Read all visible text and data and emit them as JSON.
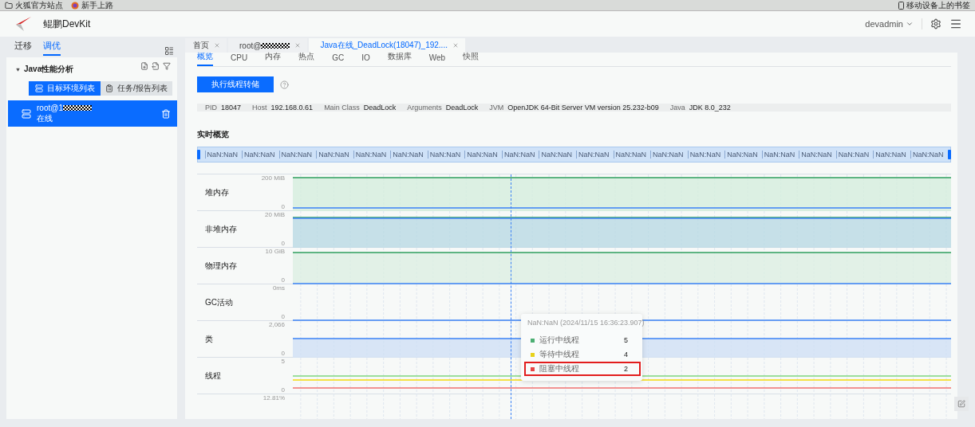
{
  "bookmarks": [
    {
      "label": "火狐官方站点",
      "kind": "folder"
    },
    {
      "label": "新手上路",
      "kind": "browser"
    }
  ],
  "mobile_bookmarks": "移动设备上的书签",
  "header": {
    "title": "鲲鹏DevKit",
    "user": "devadmin"
  },
  "sidebar": {
    "tabs": [
      {
        "label": "迁移",
        "selected": false
      },
      {
        "label": "调优",
        "selected": true
      }
    ],
    "section": {
      "label": "Java性能分析",
      "expanded": true
    },
    "views": [
      {
        "label": "目标环境列表",
        "selected": true
      },
      {
        "label": "任务/报告列表",
        "selected": false
      }
    ],
    "items": [
      {
        "name": "root@1",
        "status": "在线",
        "selected": true
      }
    ]
  },
  "tabs": [
    {
      "label": "首页",
      "selected": false
    },
    {
      "label": "root@",
      "selected": false
    },
    {
      "label": "Java在线_DeadLock(18047)_192....",
      "selected": true
    }
  ],
  "subtabs": [
    {
      "label": "概览",
      "selected": true
    },
    {
      "label": "CPU",
      "selected": false
    },
    {
      "label": "内存",
      "selected": false
    },
    {
      "label": "热点",
      "selected": false
    },
    {
      "label": "GC",
      "selected": false
    },
    {
      "label": "IO",
      "selected": false
    },
    {
      "label": "数据库",
      "selected": false
    },
    {
      "label": "Web",
      "selected": false
    },
    {
      "label": "快照",
      "selected": false
    }
  ],
  "dump_button": "执行线程转储",
  "info": [
    {
      "key": "PID",
      "value": "18047"
    },
    {
      "key": "Host",
      "value": "192.168.0.61"
    },
    {
      "key": "Main Class",
      "value": "DeadLock"
    },
    {
      "key": "Arguments",
      "value": "DeadLock"
    },
    {
      "key": "JVM",
      "value": "OpenJDK 64-Bit Server VM version 25.232-b09"
    },
    {
      "key": "Java",
      "value": "JDK 8.0_232"
    }
  ],
  "section_title": "实时概览",
  "timeline": {
    "level": 1,
    "labels": [
      "NaN:NaN",
      "NaN:NaN",
      "NaN:NaN",
      "NaN:NaN",
      "NaN:NaN",
      "NaN:NaN",
      "NaN:NaN",
      "NaN:NaN",
      "NaN:NaN",
      "NaN:NaN",
      "NaN:NaN",
      "NaN:NaN",
      "NaN:NaN",
      "NaN:NaN",
      "NaN:NaN",
      "NaN:NaN",
      "NaN:NaN",
      "NaN:NaN",
      "NaN:NaN",
      "NaN:NaN"
    ]
  },
  "metrics": [
    {
      "label": "堆内存",
      "max": "200 MiB",
      "min": "0",
      "kind": "heap"
    },
    {
      "label": "非堆内存",
      "max": "20 MiB",
      "min": "0",
      "kind": "nonheap"
    },
    {
      "label": "物理内存",
      "max": "10 GiB",
      "min": "0",
      "kind": "physical"
    },
    {
      "label": "GC活动",
      "max": "0ms",
      "min": "0",
      "kind": "gc"
    },
    {
      "label": "类",
      "max": "2,066",
      "min": "0",
      "kind": "classes"
    },
    {
      "label": "线程",
      "max": "5",
      "min": "0",
      "kind": "threads"
    },
    {
      "max": "12.81%",
      "kind": "cpu"
    }
  ],
  "tooltip": {
    "title": "NaN:NaN (2024/11/15 16:36:23.907)",
    "rows": [
      {
        "label": "运行中线程",
        "value": "5",
        "color": "#4caf73",
        "highlighted": false
      },
      {
        "label": "等待中线程",
        "value": "4",
        "color": "#e8d21a",
        "highlighted": false
      },
      {
        "label": "阻塞中线程",
        "value": "2",
        "color": "#e84545",
        "highlighted": true
      }
    ]
  }
}
